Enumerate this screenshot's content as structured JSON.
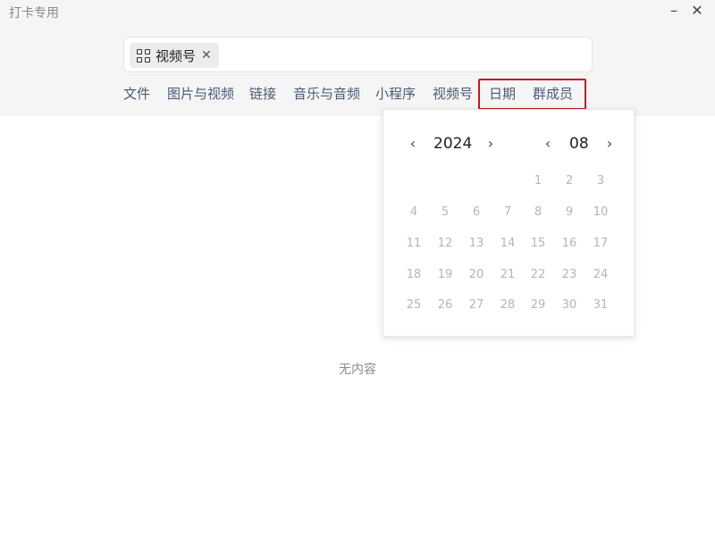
{
  "window": {
    "title": "打卡专用",
    "minimize": "–",
    "close": "✕"
  },
  "search": {
    "chip_icon": "grid-icon",
    "chip_label": "视频号",
    "chip_close": "✕"
  },
  "categories": [
    "文件",
    "图片与视频",
    "链接",
    "音乐与音频",
    "小程序",
    "视频号",
    "日期",
    "群成员"
  ],
  "calendar": {
    "prev_year": "‹",
    "year": "2024",
    "next_year": "›",
    "prev_month": "‹",
    "month": "08",
    "next_month": "›",
    "days": [
      "1",
      "2",
      "3",
      "4",
      "5",
      "6",
      "7",
      "8",
      "9",
      "10",
      "11",
      "12",
      "13",
      "14",
      "15",
      "16",
      "17",
      "18",
      "19",
      "20",
      "21",
      "22",
      "23",
      "24",
      "25",
      "26",
      "27",
      "28",
      "29",
      "30",
      "31"
    ]
  },
  "empty_text": "无内容",
  "colors": {
    "highlight": "#c8161d",
    "header_bg": "#f5f5f5",
    "category_text": "#4a5a73"
  }
}
